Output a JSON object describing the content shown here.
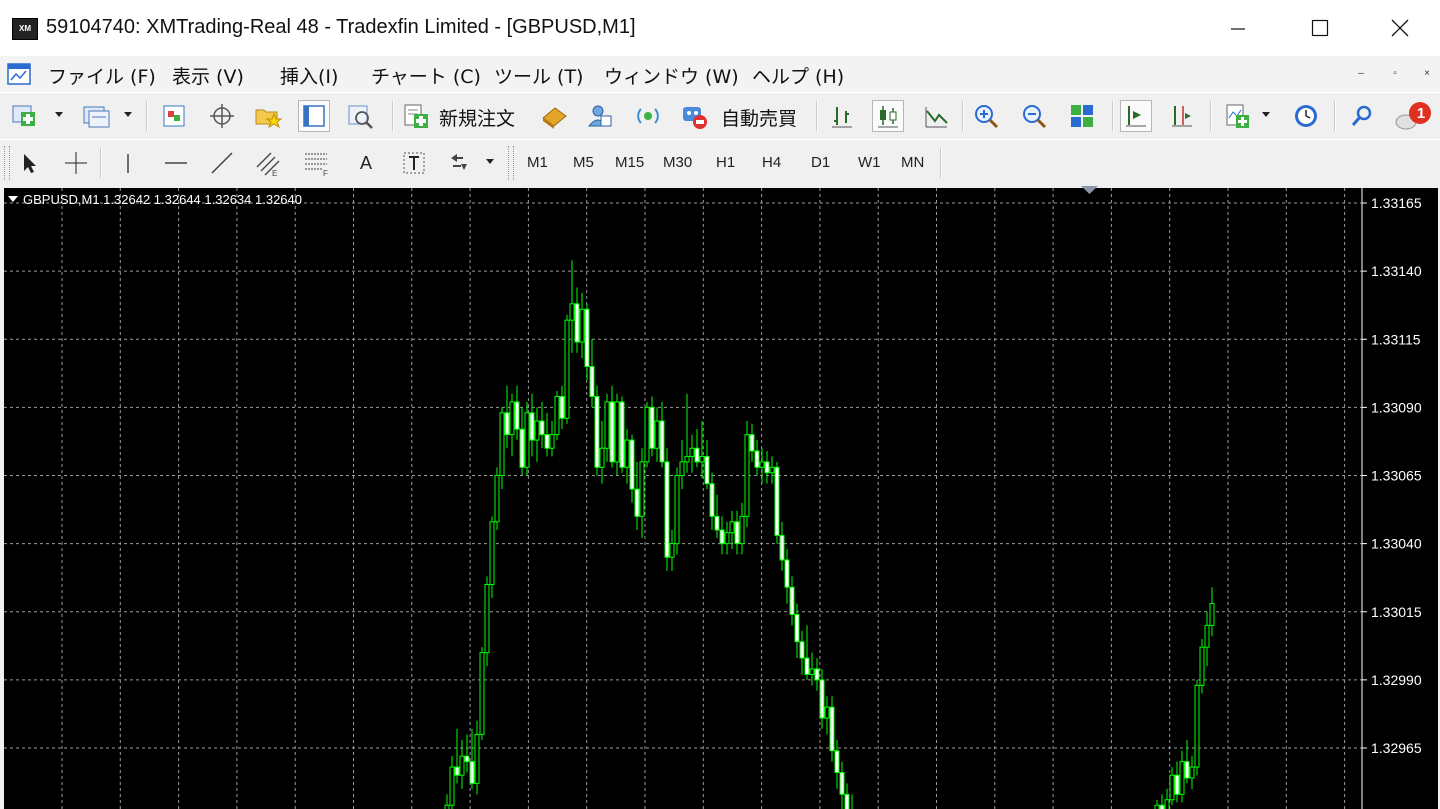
{
  "window": {
    "title": "59104740: XMTrading-Real 48 - Tradexfin Limited - [GBPUSD,M1]",
    "logo_text": "XM"
  },
  "menu": {
    "items": [
      "ファイル (F)",
      "表示 (V)",
      "挿入(I)",
      "チャート (C)",
      "ツール (T)",
      "ウィンドウ (W)",
      "ヘルプ (H)"
    ]
  },
  "toolbar": {
    "new_order_label": "新規注文",
    "auto_trading_label": "自動売買",
    "alerts_count": "1",
    "text_tool_label": "A",
    "timeframes": [
      "M1",
      "M5",
      "M15",
      "M30",
      "H1",
      "H4",
      "D1",
      "W1",
      "MN"
    ]
  },
  "chart": {
    "symbol_line": "GBPUSD,M1  1.32642 1.32644 1.32634 1.32640",
    "background": "#000000",
    "candle_color": "#00ff00",
    "up_body_color": "#000000",
    "down_body_color": "#ffffff",
    "grid_color": "#9a9a9a",
    "price_labels": [
      "1.33165",
      "1.33140",
      "1.33115",
      "1.33090",
      "1.33065",
      "1.33040",
      "1.33015",
      "1.32990",
      "1.32965"
    ],
    "ylim": [
      1.32945,
      1.33172
    ]
  },
  "chart_data": {
    "type": "candlestick",
    "title": "GBPUSD,M1",
    "ylabel": "",
    "ylim": [
      1.32945,
      1.33172
    ],
    "y_ticks": [
      1.33165,
      1.3314,
      1.33115,
      1.3309,
      1.33065,
      1.3304,
      1.33015,
      1.3299,
      1.32965
    ],
    "grid": true,
    "candles": [
      [
        1.32938,
        1.32948,
        1.3293,
        1.32944
      ],
      [
        1.32944,
        1.32962,
        1.3294,
        1.32958
      ],
      [
        1.32958,
        1.32972,
        1.32952,
        1.32955
      ],
      [
        1.32955,
        1.32968,
        1.3295,
        1.32962
      ],
      [
        1.32962,
        1.3297,
        1.32956,
        1.3296
      ],
      [
        1.3296,
        1.32972,
        1.3295,
        1.32952
      ],
      [
        1.32952,
        1.32975,
        1.32948,
        1.3297
      ],
      [
        1.3297,
        1.33002,
        1.32968,
        1.33
      ],
      [
        1.33,
        1.33028,
        1.32995,
        1.33025
      ],
      [
        1.33025,
        1.3305,
        1.3302,
        1.33048
      ],
      [
        1.33048,
        1.33068,
        1.33045,
        1.33065
      ],
      [
        1.33065,
        1.3309,
        1.3306,
        1.33088
      ],
      [
        1.33088,
        1.33098,
        1.33075,
        1.3308
      ],
      [
        1.3308,
        1.33095,
        1.33072,
        1.33092
      ],
      [
        1.33092,
        1.33098,
        1.33078,
        1.33082
      ],
      [
        1.33082,
        1.3309,
        1.33065,
        1.33068
      ],
      [
        1.33068,
        1.33092,
        1.33065,
        1.33088
      ],
      [
        1.33088,
        1.33095,
        1.33072,
        1.33078
      ],
      [
        1.33078,
        1.3309,
        1.3307,
        1.33085
      ],
      [
        1.33085,
        1.33092,
        1.33075,
        1.3308
      ],
      [
        1.3308,
        1.33088,
        1.33072,
        1.33075
      ],
      [
        1.33075,
        1.33085,
        1.33072,
        1.3308
      ],
      [
        1.3308,
        1.33096,
        1.33078,
        1.33094
      ],
      [
        1.33094,
        1.33098,
        1.33082,
        1.33086
      ],
      [
        1.33086,
        1.33124,
        1.33084,
        1.33122
      ],
      [
        1.33122,
        1.33144,
        1.3311,
        1.33128
      ],
      [
        1.33128,
        1.33134,
        1.3311,
        1.33114
      ],
      [
        1.33114,
        1.33132,
        1.33108,
        1.33126
      ],
      [
        1.33126,
        1.33128,
        1.331,
        1.33105
      ],
      [
        1.33105,
        1.33115,
        1.3309,
        1.33094
      ],
      [
        1.33094,
        1.33098,
        1.33065,
        1.33068
      ],
      [
        1.33068,
        1.33085,
        1.33062,
        1.33075
      ],
      [
        1.33075,
        1.33095,
        1.3307,
        1.33092
      ],
      [
        1.33092,
        1.33098,
        1.33068,
        1.3307
      ],
      [
        1.3307,
        1.33095,
        1.33065,
        1.33092
      ],
      [
        1.33092,
        1.33094,
        1.33066,
        1.33068
      ],
      [
        1.33068,
        1.33082,
        1.33062,
        1.33078
      ],
      [
        1.33078,
        1.3308,
        1.33055,
        1.3306
      ],
      [
        1.3306,
        1.3307,
        1.33045,
        1.3305
      ],
      [
        1.3305,
        1.33075,
        1.33042,
        1.3307
      ],
      [
        1.3307,
        1.33092,
        1.33068,
        1.3309
      ],
      [
        1.3309,
        1.33094,
        1.33072,
        1.33075
      ],
      [
        1.33075,
        1.3309,
        1.3307,
        1.33085
      ],
      [
        1.33085,
        1.33092,
        1.33068,
        1.3307
      ],
      [
        1.3307,
        1.33075,
        1.3303,
        1.33035
      ],
      [
        1.33035,
        1.33045,
        1.3303,
        1.3304
      ],
      [
        1.3304,
        1.33068,
        1.33036,
        1.33065
      ],
      [
        1.33065,
        1.33078,
        1.3306,
        1.3307
      ],
      [
        1.3307,
        1.33095,
        1.33066,
        1.33072
      ],
      [
        1.33072,
        1.3308,
        1.33066,
        1.33075
      ],
      [
        1.33075,
        1.33082,
        1.33068,
        1.3307
      ],
      [
        1.3307,
        1.33085,
        1.33064,
        1.33072
      ],
      [
        1.33072,
        1.33078,
        1.3306,
        1.33062
      ],
      [
        1.33062,
        1.33066,
        1.33045,
        1.3305
      ],
      [
        1.3305,
        1.33058,
        1.33042,
        1.33045
      ],
      [
        1.33045,
        1.3305,
        1.33036,
        1.3304
      ],
      [
        1.3304,
        1.33048,
        1.33036,
        1.33044
      ],
      [
        1.33044,
        1.33052,
        1.33038,
        1.33048
      ],
      [
        1.33048,
        1.33052,
        1.33036,
        1.3304
      ],
      [
        1.3304,
        1.33055,
        1.33036,
        1.3305
      ],
      [
        1.3305,
        1.33085,
        1.33046,
        1.3308
      ],
      [
        1.3308,
        1.33084,
        1.3307,
        1.33074
      ],
      [
        1.33074,
        1.33078,
        1.33065,
        1.33068
      ],
      [
        1.33068,
        1.33075,
        1.33062,
        1.3307
      ],
      [
        1.3307,
        1.33074,
        1.33062,
        1.33066
      ],
      [
        1.33066,
        1.33072,
        1.33062,
        1.33068
      ],
      [
        1.33068,
        1.3307,
        1.3304,
        1.33043
      ],
      [
        1.33043,
        1.33048,
        1.3303,
        1.33034
      ],
      [
        1.33034,
        1.33038,
        1.33018,
        1.33024
      ],
      [
        1.33024,
        1.33028,
        1.3301,
        1.33014
      ],
      [
        1.33014,
        1.33018,
        1.32998,
        1.33004
      ],
      [
        1.33004,
        1.33008,
        1.32992,
        1.32998
      ],
      [
        1.32998,
        1.3301,
        1.3299,
        1.32992
      ],
      [
        1.32992,
        1.33,
        1.32988,
        1.32994
      ],
      [
        1.32994,
        1.32998,
        1.32986,
        1.3299
      ],
      [
        1.3299,
        1.32994,
        1.32972,
        1.32976
      ],
      [
        1.32976,
        1.32984,
        1.3297,
        1.3298
      ],
      [
        1.3298,
        1.32984,
        1.3296,
        1.32964
      ],
      [
        1.32964,
        1.32968,
        1.3295,
        1.32956
      ],
      [
        1.32956,
        1.3296,
        1.32942,
        1.32948
      ],
      [
        1.32948,
        1.32952,
        1.32938,
        1.32942
      ],
      [
        1.32942,
        1.32948,
        1.32936,
        1.3294
      ],
      null,
      null,
      null,
      null,
      null,
      null,
      null,
      null,
      null,
      null,
      null,
      null,
      null,
      null,
      null,
      null,
      null,
      null,
      null,
      null,
      null,
      null,
      null,
      null,
      null,
      null,
      null,
      null,
      null,
      null,
      null,
      null,
      null,
      null,
      null,
      null,
      null,
      null,
      null,
      null,
      null,
      null,
      null,
      null,
      null,
      null,
      null,
      null,
      null,
      null,
      null,
      null,
      null,
      null,
      null,
      null,
      null,
      null,
      null,
      null,
      [
        1.3294,
        1.32946,
        1.32936,
        1.32944
      ],
      [
        1.32944,
        1.32948,
        1.32938,
        1.32942
      ],
      [
        1.32942,
        1.3295,
        1.32938,
        1.32946
      ],
      [
        1.32946,
        1.32958,
        1.32944,
        1.32955
      ],
      [
        1.32955,
        1.3296,
        1.32945,
        1.32948
      ],
      [
        1.32948,
        1.32964,
        1.32945,
        1.3296
      ],
      [
        1.3296,
        1.32968,
        1.32952,
        1.32954
      ],
      [
        1.32954,
        1.32962,
        1.3295,
        1.32958
      ],
      [
        1.32958,
        1.3299,
        1.32955,
        1.32988
      ],
      [
        1.32988,
        1.33005,
        1.32985,
        1.33002
      ],
      [
        1.33002,
        1.33015,
        1.32995,
        1.3301
      ],
      [
        1.3301,
        1.33024,
        1.33006,
        1.33018
      ]
    ]
  }
}
